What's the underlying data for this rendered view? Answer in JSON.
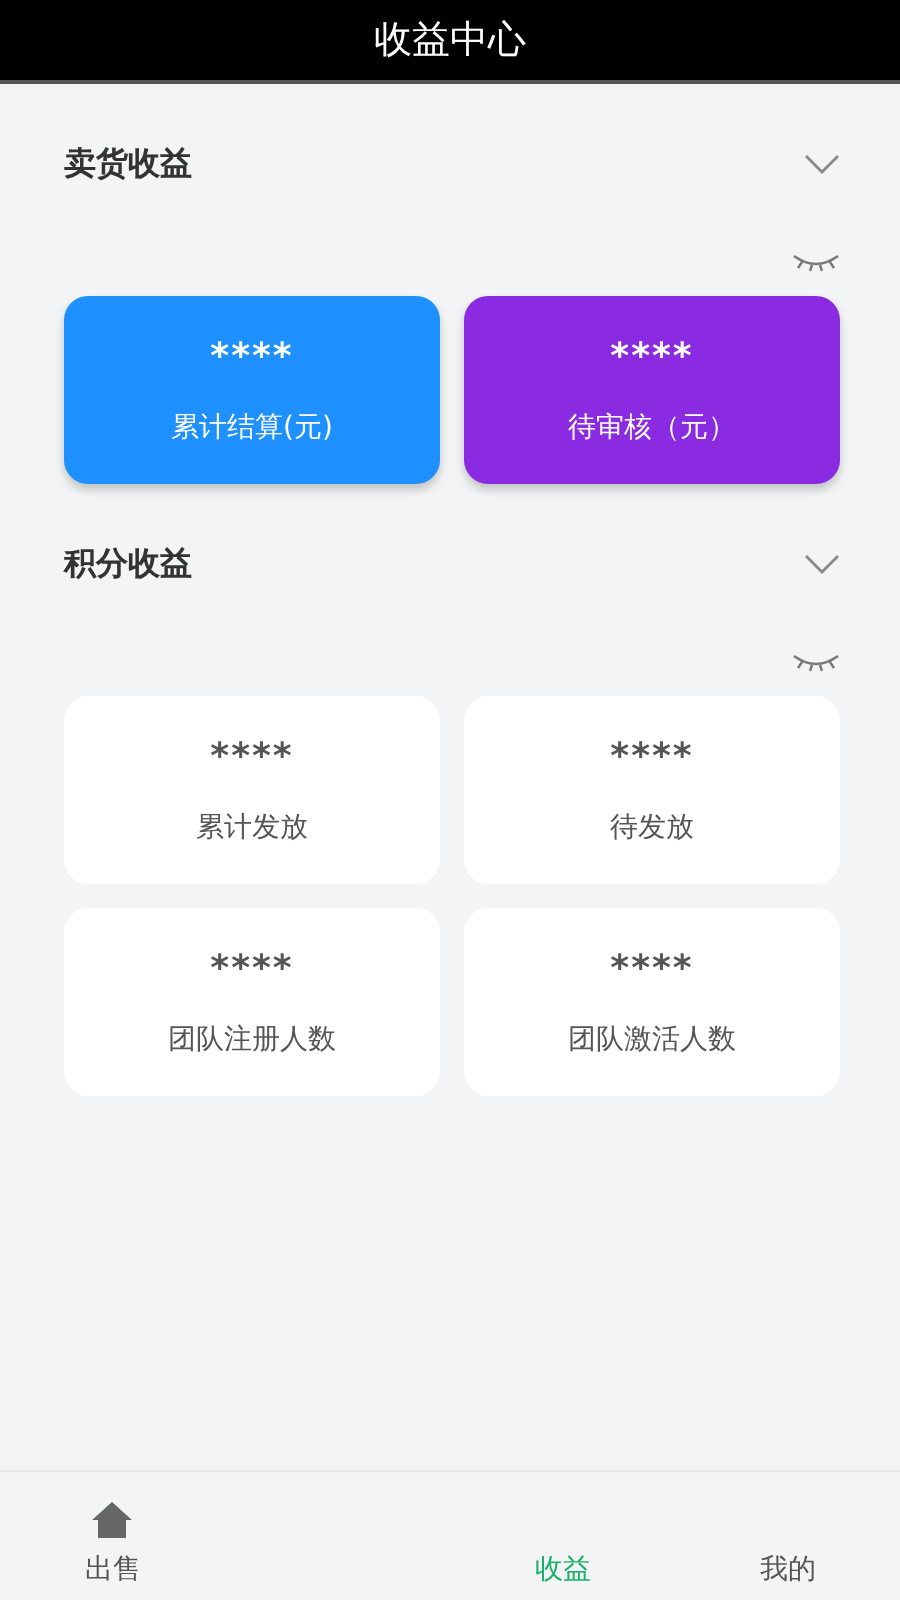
{
  "header": {
    "title": "收益中心"
  },
  "sections": [
    {
      "title": "卖货收益",
      "expanded": false,
      "kind": "colored",
      "cards": [
        {
          "value": "****",
          "label": "累计结算(元)",
          "color": "#1e90ff"
        },
        {
          "value": "****",
          "label": "待审核（元）",
          "color": "#8a2be2"
        }
      ]
    },
    {
      "title": "积分收益",
      "expanded": false,
      "kind": "plain",
      "cards": [
        {
          "value": "****",
          "label": "累计发放"
        },
        {
          "value": "****",
          "label": "待发放"
        },
        {
          "value": "****",
          "label": "团队注册人数"
        },
        {
          "value": "****",
          "label": "团队激活人数"
        }
      ]
    }
  ],
  "tab_bar": [
    {
      "label": "出售",
      "selected": false,
      "icon": true
    },
    {
      "label": "收益",
      "selected": true
    },
    {
      "label": "我的",
      "selected": false
    }
  ]
}
